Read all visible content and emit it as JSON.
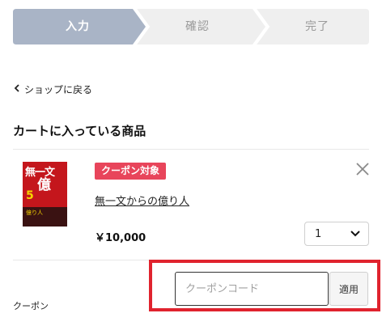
{
  "steps": [
    {
      "label": "入力",
      "state": "active"
    },
    {
      "label": "確認",
      "state": "pending"
    },
    {
      "label": "完了",
      "state": "pending"
    }
  ],
  "colors": {
    "step_active": "#a9b4c6",
    "step_pending": "#efefef",
    "badge": "#e8455b",
    "highlight": "#e0232e"
  },
  "back_link": {
    "label": "ショップに戻る",
    "icon": "chevron-left-icon"
  },
  "cart": {
    "title": "カートに入っている商品",
    "item": {
      "badge": "クーポン対象",
      "name": "無一文からの億り人",
      "price": "￥10,000",
      "quantity": "1",
      "cover_text": {
        "line1": "無一文",
        "line2": "億",
        "line3": "5",
        "band": "億り人"
      }
    }
  },
  "coupon": {
    "label": "クーポン",
    "placeholder": "クーポンコード",
    "value": "",
    "apply_label": "適用"
  }
}
